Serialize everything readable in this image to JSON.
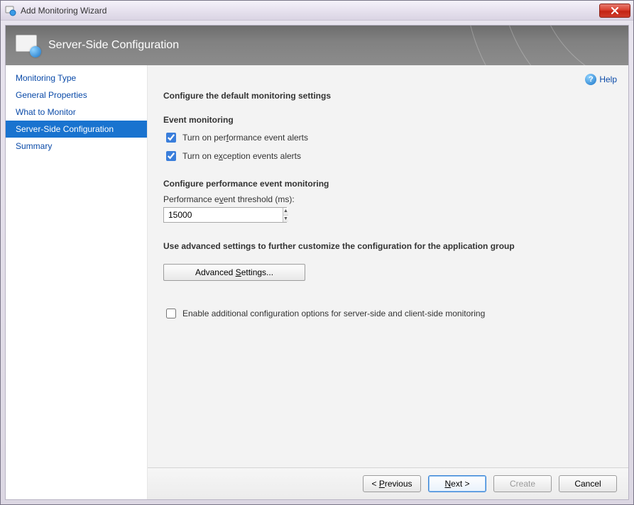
{
  "window": {
    "title": "Add Monitoring Wizard"
  },
  "banner": {
    "title": "Server-Side Configuration"
  },
  "sidebar": {
    "items": [
      {
        "label": "Monitoring Type"
      },
      {
        "label": "General Properties"
      },
      {
        "label": "What to Monitor"
      },
      {
        "label": "Server-Side Configuration"
      },
      {
        "label": "Summary"
      }
    ],
    "active_index": 3
  },
  "help": {
    "label": "Help"
  },
  "main": {
    "heading": "Configure the default monitoring settings",
    "event_monitoring": {
      "heading": "Event monitoring",
      "perf_alerts": {
        "label": "Turn on performance event alerts",
        "checked": true
      },
      "exception_alerts": {
        "label": "Turn on exception events alerts",
        "checked": true
      }
    },
    "perf_config": {
      "heading": "Configure performance event monitoring",
      "threshold_label": "Performance event threshold (ms):",
      "threshold_value": "15000"
    },
    "advanced": {
      "heading": "Use advanced settings to further customize the configuration for the application group",
      "button": "Advanced Settings..."
    },
    "additional": {
      "label": "Enable additional configuration options for server-side and client-side monitoring",
      "checked": false
    }
  },
  "footer": {
    "previous": "< Previous",
    "next": "Next >",
    "create": "Create",
    "cancel": "Cancel"
  }
}
